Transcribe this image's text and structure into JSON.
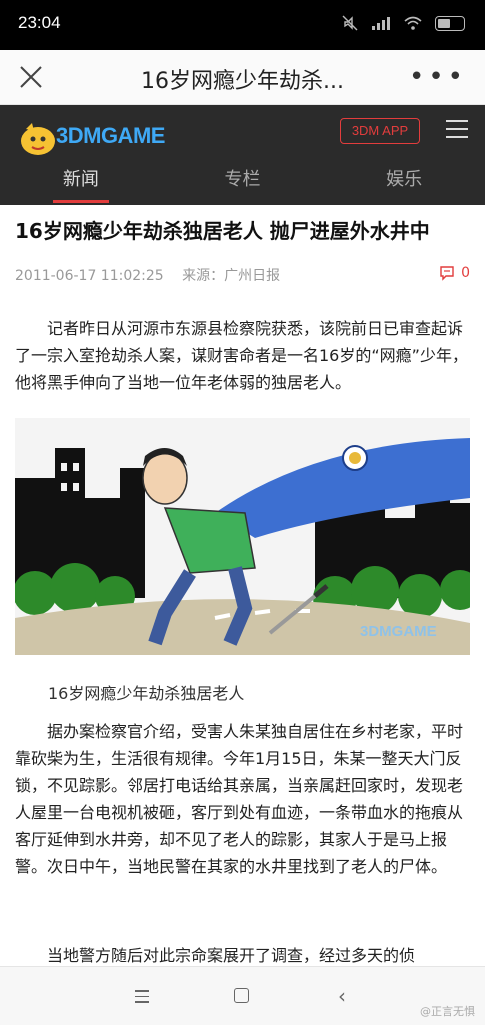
{
  "status_bar": {
    "time": "23:04"
  },
  "browser": {
    "title": "16岁网瘾少年劫杀..."
  },
  "site": {
    "logo_text": "3DMGAME",
    "app_button": "3DM APP",
    "tabs": [
      {
        "label": "新闻",
        "active": true
      },
      {
        "label": "专栏",
        "active": false
      },
      {
        "label": "娱乐",
        "active": false
      }
    ],
    "accent_color": "#e23d3d"
  },
  "article": {
    "headline": "16岁网瘾少年劫杀独居老人 抛尸进屋外水井中",
    "datetime": "2011-06-17 11:02:25",
    "source": "来源：广州日报",
    "comment_count": "0",
    "para1": "记者昨日从河源市东源县检察院获悉，该院前日已审查起诉了一宗入室抢劫杀人案，谋财害命者是一名16岁的“网瘾”少年，他将黑手伸向了当地一位年老体弱的独居老人。",
    "image_watermark": "3DMGAME",
    "caption": "16岁网瘾少年劫杀独居老人",
    "para2": "据办案检察官介绍，受害人朱某独自居住在乡村老家，平时靠砍柴为生，生活很有规律。今年1月15日，朱某一整天大门反锁，不见踪影。邻居打电话给其亲属，当亲属赶回家时，发现老人屋里一台电视机被砸，客厅到处有血迹，一条带血水的拖痕从客厅延伸到水井旁，却不见了老人的踪影，其家人于是马上报警。次日中午，当地民警在其家的水井里找到了老人的尸体。",
    "para3": "当地警方随后对此宗命案展开了调查，经过多天的侦"
  },
  "system_nav": {
    "watermark": "@正言无惧"
  }
}
